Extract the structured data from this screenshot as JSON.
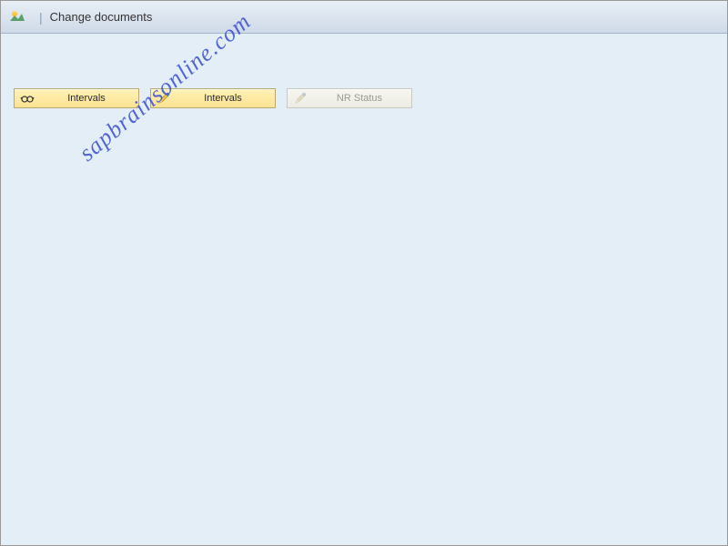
{
  "titlebar": {
    "title": "Change documents"
  },
  "buttons": {
    "intervals_display": {
      "label": "Intervals"
    },
    "intervals_edit": {
      "label": "Intervals"
    },
    "nr_status": {
      "label": "NR Status"
    }
  },
  "watermark": {
    "text": "sapbrainsonline.com"
  }
}
